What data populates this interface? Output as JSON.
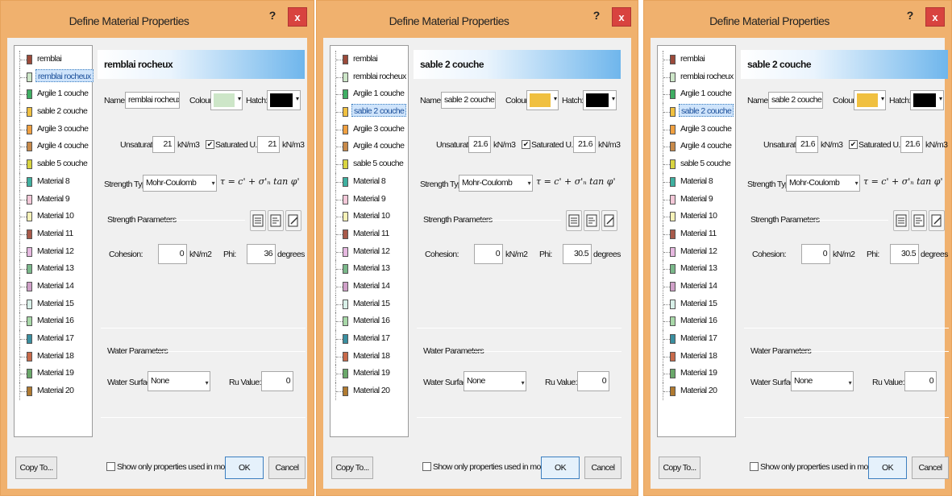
{
  "colors": {
    "accent": "#6fb6ec",
    "close": "#d8433f",
    "frame": "#f0b16e"
  },
  "dialogs": [
    {
      "title": "Define Material Properties",
      "help_label": "?",
      "close_label": "x",
      "selected_index": 1,
      "materials": [
        {
          "name": "remblai",
          "color": "#9b4a3a"
        },
        {
          "name": "remblai rocheux",
          "color": "#cde6c8"
        },
        {
          "name": "Argile 1 couche",
          "color": "#3fae63"
        },
        {
          "name": "sable 2 couche",
          "color": "#f0c040"
        },
        {
          "name": "Argile 3 couche",
          "color": "#f0a040"
        },
        {
          "name": "Argile 4 couche",
          "color": "#c88a4a"
        },
        {
          "name": "sable 5 couche",
          "color": "#d9d440"
        },
        {
          "name": "Material 8",
          "color": "#3fb0a0"
        },
        {
          "name": "Material 9",
          "color": "#f4c8d8"
        },
        {
          "name": "Material 10",
          "color": "#f6f2b8"
        },
        {
          "name": "Material 11",
          "color": "#a85a4a"
        },
        {
          "name": "Material 12",
          "color": "#e6b8e0"
        },
        {
          "name": "Material 13",
          "color": "#7ab88a"
        },
        {
          "name": "Material 14",
          "color": "#d0a0c8"
        },
        {
          "name": "Material 15",
          "color": "#d8f0e8"
        },
        {
          "name": "Material 16",
          "color": "#a8d8a8"
        },
        {
          "name": "Material 17",
          "color": "#3a8fa0"
        },
        {
          "name": "Material 18",
          "color": "#c86a4a"
        },
        {
          "name": "Material 19",
          "color": "#6aa86a"
        },
        {
          "name": "Material 20",
          "color": "#b07a30"
        }
      ],
      "header": "remblai rocheux",
      "name_label": "Name:",
      "name_value": "remblai rocheux",
      "colour_label": "Colour:",
      "colour_value": "#cde6c8",
      "hatch_label": "Hatch:",
      "unsat_label": "Unsaturated",
      "unsat_value": "21",
      "unit_weight": "kN/m3",
      "sat_label": "Saturated U.W.",
      "sat_checked": "✔",
      "sat_value": "21",
      "strength_type_label": "Strength Type:",
      "strength_type_value": "Mohr-Coulomb",
      "formula": "τ = c' + σ'ₙ tan φ'",
      "strength_params_label": "Strength Parameters",
      "cohesion_label": "Cohesion:",
      "cohesion_value": "0",
      "cohesion_unit": "kN/m2",
      "phi_label": "Phi:",
      "phi_value": "36",
      "phi_unit": "degrees",
      "water_params_label": "Water Parameters",
      "water_surface_label": "Water Surface:",
      "water_surface_value": "None",
      "ru_label": "Ru Value:",
      "ru_value": "0",
      "copy_label": "Copy To...",
      "show_only_label": "Show only properties used in model",
      "ok_label": "OK",
      "cancel_label": "Cancel"
    },
    {
      "title": "Define Material Properties",
      "help_label": "?",
      "close_label": "x",
      "selected_index": 3,
      "materials": [
        {
          "name": "remblai",
          "color": "#9b4a3a"
        },
        {
          "name": "remblai rocheux",
          "color": "#cde6c8"
        },
        {
          "name": "Argile 1 couche",
          "color": "#3fae63"
        },
        {
          "name": "sable 2 couche",
          "color": "#f0c040"
        },
        {
          "name": "Argile 3 couche",
          "color": "#f0a040"
        },
        {
          "name": "Argile 4 couche",
          "color": "#c88a4a"
        },
        {
          "name": "sable 5 couche",
          "color": "#d9d440"
        },
        {
          "name": "Material 8",
          "color": "#3fb0a0"
        },
        {
          "name": "Material 9",
          "color": "#f4c8d8"
        },
        {
          "name": "Material 10",
          "color": "#f6f2b8"
        },
        {
          "name": "Material 11",
          "color": "#a85a4a"
        },
        {
          "name": "Material 12",
          "color": "#e6b8e0"
        },
        {
          "name": "Material 13",
          "color": "#7ab88a"
        },
        {
          "name": "Material 14",
          "color": "#d0a0c8"
        },
        {
          "name": "Material 15",
          "color": "#d8f0e8"
        },
        {
          "name": "Material 16",
          "color": "#a8d8a8"
        },
        {
          "name": "Material 17",
          "color": "#3a8fa0"
        },
        {
          "name": "Material 18",
          "color": "#c86a4a"
        },
        {
          "name": "Material 19",
          "color": "#6aa86a"
        },
        {
          "name": "Material 20",
          "color": "#b07a30"
        }
      ],
      "header": "sable 2 couche",
      "name_label": "Name:",
      "name_value": "sable 2 couche",
      "colour_label": "Colour:",
      "colour_value": "#f0c040",
      "hatch_label": "Hatch:",
      "unsat_label": "Unsaturated",
      "unsat_value": "21.6",
      "unit_weight": "kN/m3",
      "sat_label": "Saturated U.W.",
      "sat_checked": "✔",
      "sat_value": "21.6",
      "strength_type_label": "Strength Type:",
      "strength_type_value": "Mohr-Coulomb",
      "formula": "τ = c' + σ'ₙ tan φ'",
      "strength_params_label": "Strength Parameters",
      "cohesion_label": "Cohesion:",
      "cohesion_value": "0",
      "cohesion_unit": "kN/m2",
      "phi_label": "Phi:",
      "phi_value": "30.5",
      "phi_unit": "degrees",
      "water_params_label": "Water Parameters",
      "water_surface_label": "Water Surface:",
      "water_surface_value": "None",
      "ru_label": "Ru Value:",
      "ru_value": "0",
      "copy_label": "Copy To...",
      "show_only_label": "Show only properties used in model",
      "ok_label": "OK",
      "cancel_label": "Cancel"
    },
    {
      "title": "Define Material Properties",
      "help_label": "?",
      "close_label": "x",
      "selected_index": 3,
      "materials": [
        {
          "name": "remblai",
          "color": "#9b4a3a"
        },
        {
          "name": "remblai rocheux",
          "color": "#cde6c8"
        },
        {
          "name": "Argile 1 couche",
          "color": "#3fae63"
        },
        {
          "name": "sable 2 couche",
          "color": "#f0c040"
        },
        {
          "name": "Argile 3 couche",
          "color": "#f0a040"
        },
        {
          "name": "Argile 4 couche",
          "color": "#c88a4a"
        },
        {
          "name": "sable 5 couche",
          "color": "#d9d440"
        },
        {
          "name": "Material 8",
          "color": "#3fb0a0"
        },
        {
          "name": "Material 9",
          "color": "#f4c8d8"
        },
        {
          "name": "Material 10",
          "color": "#f6f2b8"
        },
        {
          "name": "Material 11",
          "color": "#a85a4a"
        },
        {
          "name": "Material 12",
          "color": "#e6b8e0"
        },
        {
          "name": "Material 13",
          "color": "#7ab88a"
        },
        {
          "name": "Material 14",
          "color": "#d0a0c8"
        },
        {
          "name": "Material 15",
          "color": "#d8f0e8"
        },
        {
          "name": "Material 16",
          "color": "#a8d8a8"
        },
        {
          "name": "Material 17",
          "color": "#3a8fa0"
        },
        {
          "name": "Material 18",
          "color": "#c86a4a"
        },
        {
          "name": "Material 19",
          "color": "#6aa86a"
        },
        {
          "name": "Material 20",
          "color": "#b07a30"
        }
      ],
      "header": "sable 2 couche",
      "name_label": "Name:",
      "name_value": "sable 2 couche",
      "colour_label": "Colour:",
      "colour_value": "#f0c040",
      "hatch_label": "Hatch:",
      "unsat_label": "Unsaturated",
      "unsat_value": "21.6",
      "unit_weight": "kN/m3",
      "sat_label": "Saturated U.W.",
      "sat_checked": "✔",
      "sat_value": "21.6",
      "strength_type_label": "Strength Type:",
      "strength_type_value": "Mohr-Coulomb",
      "formula": "τ = c' + σ'ₙ tan φ'",
      "strength_params_label": "Strength Parameters",
      "cohesion_label": "Cohesion:",
      "cohesion_value": "0",
      "cohesion_unit": "kN/m2",
      "phi_label": "Phi:",
      "phi_value": "30.5",
      "phi_unit": "degrees",
      "water_params_label": "Water Parameters",
      "water_surface_label": "Water Surface:",
      "water_surface_value": "None",
      "ru_label": "Ru Value:",
      "ru_value": "0",
      "copy_label": "Copy To...",
      "show_only_label": "Show only properties used in model",
      "ok_label": "OK",
      "cancel_label": "Cancel"
    }
  ]
}
